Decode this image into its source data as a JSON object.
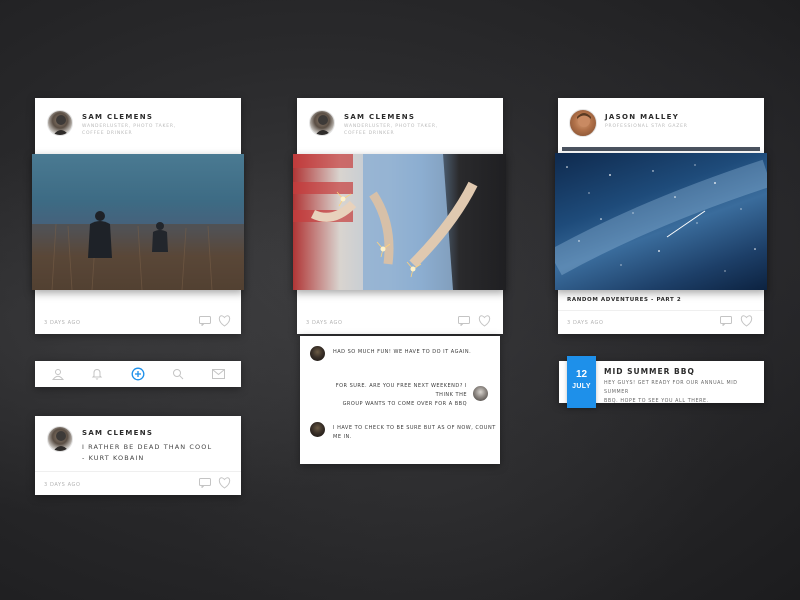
{
  "colors": {
    "accent": "#1e90ea",
    "card_bg": "#ffffff",
    "icon_gray": "#c4c4c4"
  },
  "posts": [
    {
      "author": "SAM CLEMENS",
      "bio_line1": "WANDERLUSTER, PHOTO TAKER,",
      "bio_line2": "COFFEE DRINKER",
      "date": "3 DAYS AGO"
    },
    {
      "author": "SAM CLEMENS",
      "bio_line1": "WANDERLUSTER, PHOTO TAKER,",
      "bio_line2": "COFFEE DRINKER",
      "date": "3 DAYS AGO"
    },
    {
      "author": "JASON MALLEY",
      "bio_line1": "PROFESSIONAL STAR GAZER",
      "caption": "RANDOM ADVENTURES - PART 2",
      "date": "3 DAYS AGO"
    }
  ],
  "quote_post": {
    "author": "SAM CLEMENS",
    "quote_line1": "I RATHER BE DEAD THAN COOL",
    "quote_line2": "- KURT KOBAIN",
    "date": "3 DAYS AGO"
  },
  "nav_bar": {
    "icons": [
      "user-icon",
      "bell-icon",
      "add-icon",
      "search-icon",
      "mail-icon"
    ],
    "active": "add-icon"
  },
  "chat": {
    "messages": [
      {
        "side": "left",
        "line1": "HAD SO MUCH FUN! WE HAVE TO DO IT AGAIN."
      },
      {
        "side": "right",
        "line1": "FOR SURE. ARE YOU FREE NEXT WEEKEND? I THINK THE",
        "line2": "GROUP WANTS TO COME OVER FOR A BBQ"
      },
      {
        "side": "left",
        "line1": "I HAVE TO CHECK TO BE SURE BUT AS OF NOW, COUNT ME IN."
      }
    ]
  },
  "event": {
    "day": "12",
    "month": "JULY",
    "title": "MID SUMMER BBQ",
    "line1": "HEY GUYS! GET READY FOR OUR ANNUAL MID SUMMER",
    "line2": "BBQ. HOPE TO SEE YOU ALL THERE."
  }
}
